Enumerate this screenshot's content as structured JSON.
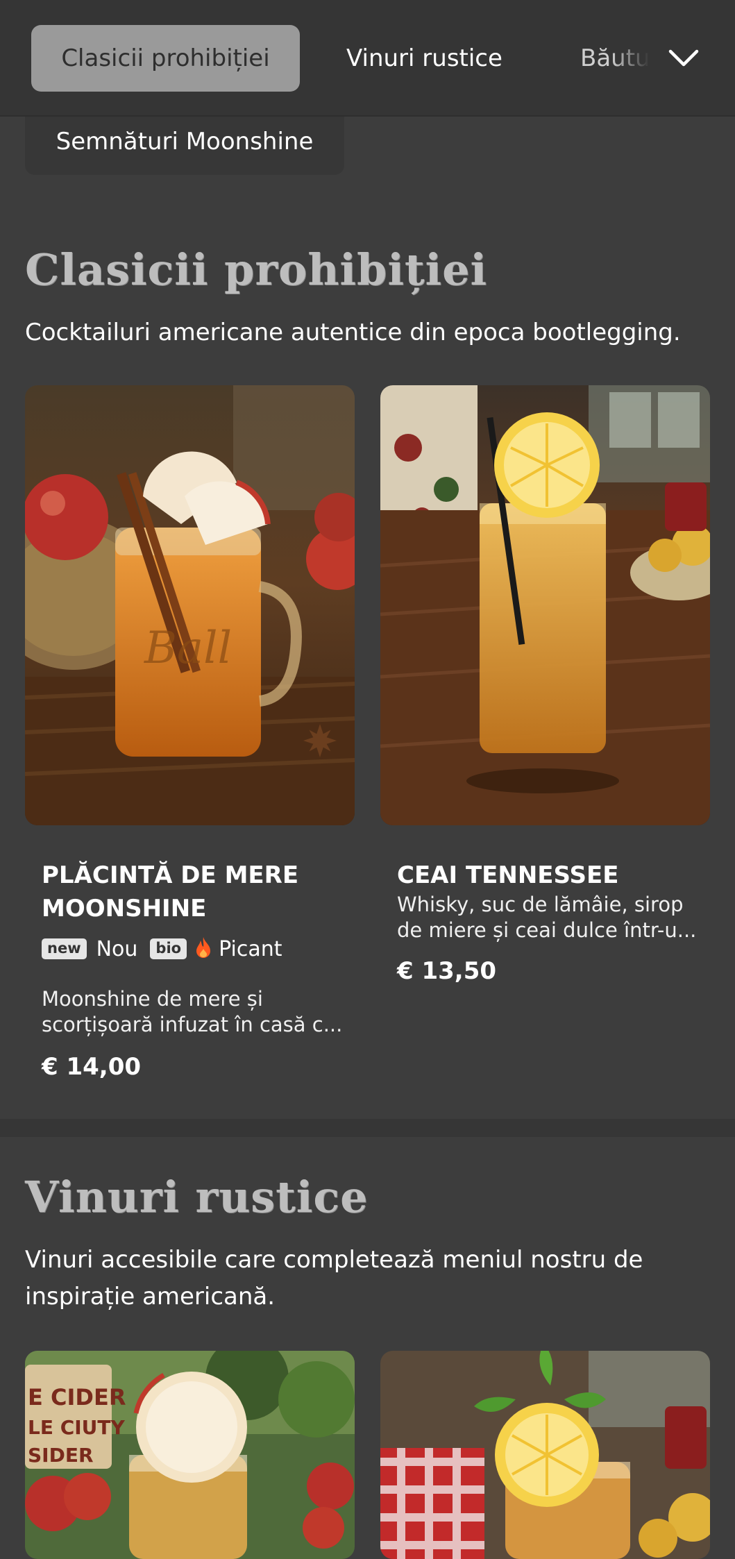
{
  "nav": {
    "tabs": [
      "Clasicii prohibiției",
      "Vinuri rustice",
      "Băutu"
    ],
    "second_row_tab": "Semnături Moonshine",
    "expand_icon": "chevron-down-icon"
  },
  "sections": [
    {
      "title": "Clasicii prohibiției",
      "description": "Cocktailuri americane autentice din epoca bootlegging.",
      "items": [
        {
          "name": "Plăcintă de mere Moonshine",
          "badges": [
            {
              "box": "new",
              "label": "Nou"
            },
            {
              "box": "bio",
              "label": ""
            },
            {
              "icon": "flame-icon",
              "label": "Picant"
            }
          ],
          "description": "Moonshine de mere și scorțișoară infuzat în casă c...",
          "price": "€ 14,00"
        },
        {
          "name": "Ceai Tennessee",
          "description": "Whisky, suc de lămâie, sirop de miere și ceai dulce într-u...",
          "price": "€ 13,50"
        }
      ]
    },
    {
      "title": "Vinuri rustice",
      "description": "Vinuri accesibile care completează meniul nostru de inspirație americană.",
      "sign_text": [
        "E CIDER",
        "LE CIUTY",
        "SIDER"
      ]
    }
  ],
  "colors": {
    "background": "#3d3d3d",
    "nav_background": "#353535",
    "active_tab": "#9a9a9a",
    "section_title": "#bdbdbd",
    "flame": "#ff5a1f"
  }
}
